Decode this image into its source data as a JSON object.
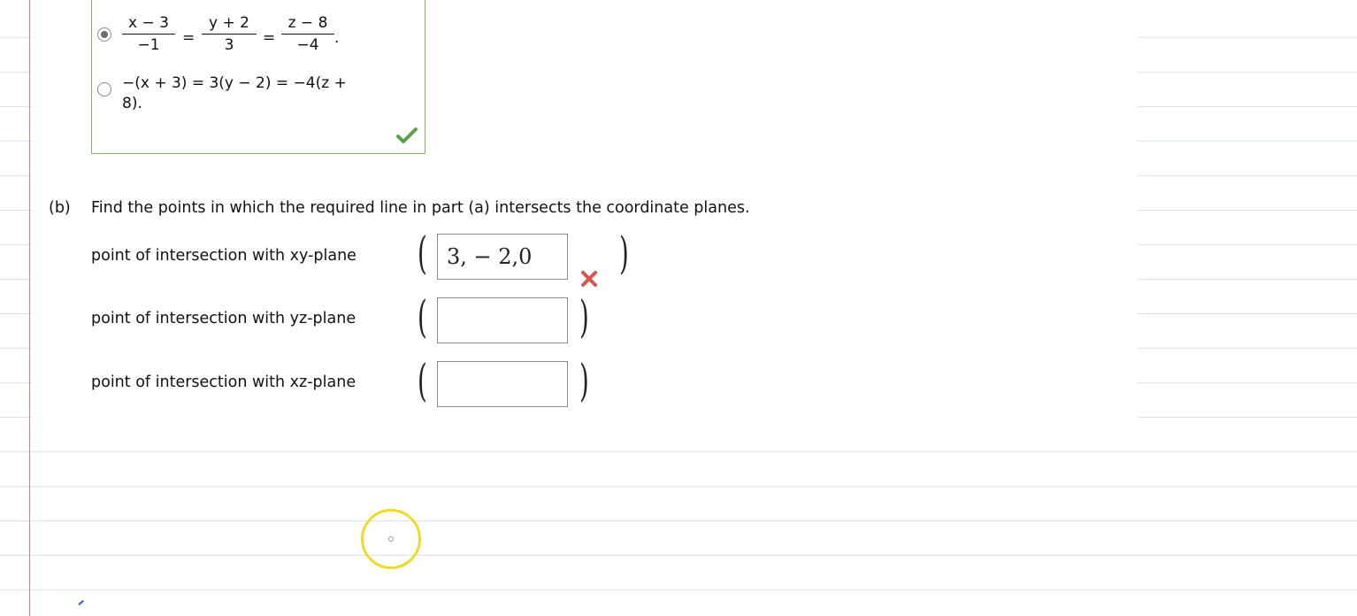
{
  "part_a": {
    "options": [
      {
        "selected": true,
        "frac1_num": "x − 3",
        "frac1_den": "−1",
        "frac2_num": "y + 2",
        "frac2_den": "3",
        "frac3_num": "z − 8",
        "frac3_den": "−4",
        "eq": "=",
        "end": "."
      },
      {
        "selected": false,
        "line1": "−(x + 3) = 3(y − 2) = −4(z +",
        "line2": "8)."
      }
    ],
    "status_icon": "checkmark-icon",
    "status_color": "#5aa343"
  },
  "part_b": {
    "label": "(b)",
    "question": "Find the points in which the required line in part (a) intersects the coordinate planes.",
    "rows": [
      {
        "label": "point of intersection with xy-plane",
        "value": "3, − 2,0",
        "status": "incorrect"
      },
      {
        "label": "point of intersection with yz-plane",
        "value": ""
      },
      {
        "label": "point of intersection with xz-plane",
        "value": ""
      }
    ],
    "incorrect_icon": "x-mark-icon",
    "incorrect_color": "#d9534f"
  },
  "paren_open": "(",
  "paren_close": ")"
}
